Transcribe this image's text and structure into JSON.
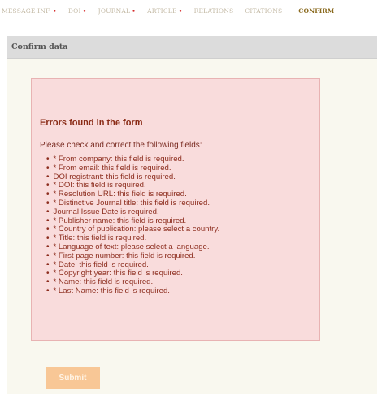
{
  "tabs": [
    {
      "label": "MESSAGE INF.",
      "required": true,
      "active": false
    },
    {
      "label": "DOI",
      "required": true,
      "active": false
    },
    {
      "label": "JOURNAL",
      "required": true,
      "active": false
    },
    {
      "label": "ARTICLE",
      "required": true,
      "active": false
    },
    {
      "label": "RELATIONS",
      "required": false,
      "active": false
    },
    {
      "label": "CITATIONS",
      "required": false,
      "active": false
    },
    {
      "label": "CONFIRM",
      "required": false,
      "active": true
    }
  ],
  "required_marker": "•",
  "panel": {
    "title": "Confirm data"
  },
  "errors": {
    "title": "Errors found in the form",
    "intro": "Please check and correct the following fields:",
    "items": [
      "* From company: this field is required.",
      "* From email: this field is required.",
      "DOI registrant: this field is required.",
      "* DOI: this field is required.",
      "* Resolution URL: this field is required.",
      "* Distinctive Journal title: this field is required.",
      "Journal Issue Date is required.",
      "* Publisher name: this field is required.",
      "* Country of publication: please select a country.",
      "* Title: this field is required.",
      "* Language of text: please select a language.",
      "* First page number: this field is required.",
      "* Date: this field is required.",
      "* Copyright year: this field is required.",
      "* Name: this field is required.",
      "* Last Name: this field is required."
    ]
  },
  "submit_label": "Submit",
  "colors": {
    "error_background": "#f9dcdc",
    "error_text": "#8d2e1f",
    "submit_disabled": "#f8c796",
    "required_marker": "#d21f1f"
  }
}
